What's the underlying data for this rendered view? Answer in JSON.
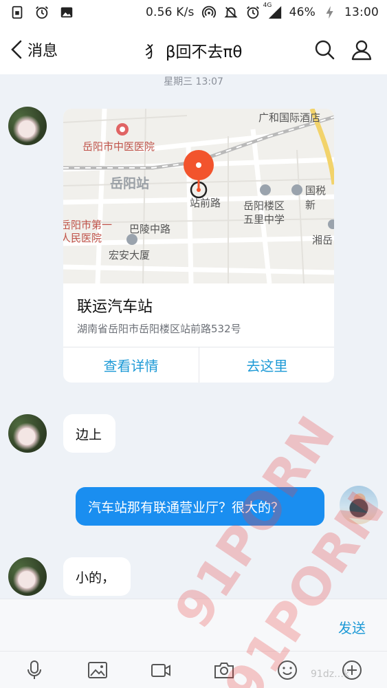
{
  "status_bar": {
    "speed": "0.56 K/s",
    "network": "4G",
    "battery": "46%",
    "time": "13:00",
    "icons": [
      "sim-icon",
      "alarm-icon",
      "image-icon",
      "hotspot-icon",
      "mute-icon",
      "alarm-icon",
      "signal-icon",
      "charging-icon"
    ]
  },
  "header": {
    "back_label": "消息",
    "title": "犭 β回不去πθ",
    "icons": [
      "back-chevron-icon",
      "search-icon",
      "profile-icon"
    ]
  },
  "chat": {
    "timestamp": "星期三 13:07",
    "location_card": {
      "name": "联运汽车站",
      "address": "湖南省岳阳市岳阳楼区站前路532号",
      "btn_details": "查看详情",
      "btn_go": "去这里",
      "map_labels": {
        "hotel": "广和国际酒店",
        "hospital_tcm": "岳阳市中医医院",
        "station": "岳阳站",
        "road_front": "站前路",
        "district": "岳阳楼区",
        "school": "五里中学",
        "tax": "国税新",
        "hospital_1": "岳阳市第一",
        "hospital_1b": "人民医院",
        "road_baling": "巴陵中路",
        "building": "宏安大厦",
        "xiangyue": "湘岳"
      }
    },
    "messages": [
      {
        "side": "in",
        "text": "边上"
      },
      {
        "side": "out",
        "text": "汽车站那有联通营业厅？很大的？"
      },
      {
        "side": "in",
        "text": "小的，"
      }
    ]
  },
  "input": {
    "placeholder": "",
    "send_label": "发送"
  },
  "toolbar": {
    "items": [
      "microphone-icon",
      "picture-icon",
      "video-icon",
      "camera-icon",
      "emoji-icon",
      "plus-icon"
    ]
  },
  "watermarks": {
    "mark_1": "91PORN",
    "mark_2": "91PORN",
    "site": "91dz…k"
  },
  "colors": {
    "accent": "#1e9ad6",
    "outgoing_bubble": "#1a8ef0",
    "chat_bg": "#eef2f7",
    "pin": "#f2542d"
  }
}
